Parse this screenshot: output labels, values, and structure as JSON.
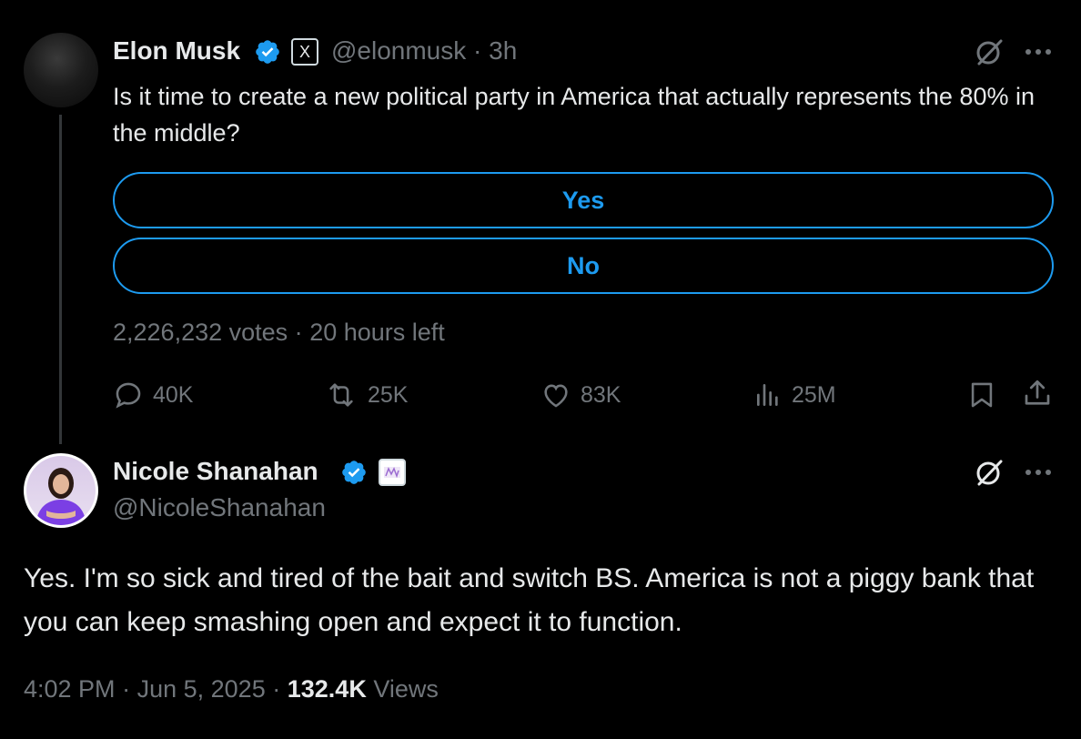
{
  "original_tweet": {
    "author_name": "Elon Musk",
    "affiliation_badge": "X",
    "handle": "@elonmusk",
    "separator": "·",
    "time_ago": "3h",
    "text": "Is it time to create a new political party in America that actually represents the 80% in the middle?",
    "poll": {
      "options": [
        "Yes",
        "No"
      ],
      "votes": "2,226,232 votes",
      "time_left": "20 hours left"
    },
    "stats": {
      "replies": "40K",
      "reposts": "25K",
      "likes": "83K",
      "views": "25M"
    }
  },
  "reply_tweet": {
    "author_name": "Nicole Shanahan",
    "handle": "@NicoleShanahan",
    "text": "Yes. I'm so sick and tired of the bait and switch BS. America is not a piggy bank that you can keep smashing open and expect it to function.",
    "time": "4:02 PM",
    "date": "Jun 5, 2025",
    "views_count": "132.4K",
    "views_label": "Views"
  },
  "colors": {
    "background": "#000000",
    "text": "#e7e9ea",
    "muted": "#71767b",
    "accent": "#1d9bf0",
    "verified": "#1d9bf0"
  },
  "icons": [
    "grok-icon",
    "more-icon",
    "reply-icon",
    "repost-icon",
    "like-icon",
    "views-icon",
    "bookmark-icon",
    "share-icon",
    "verified-badge-icon"
  ]
}
